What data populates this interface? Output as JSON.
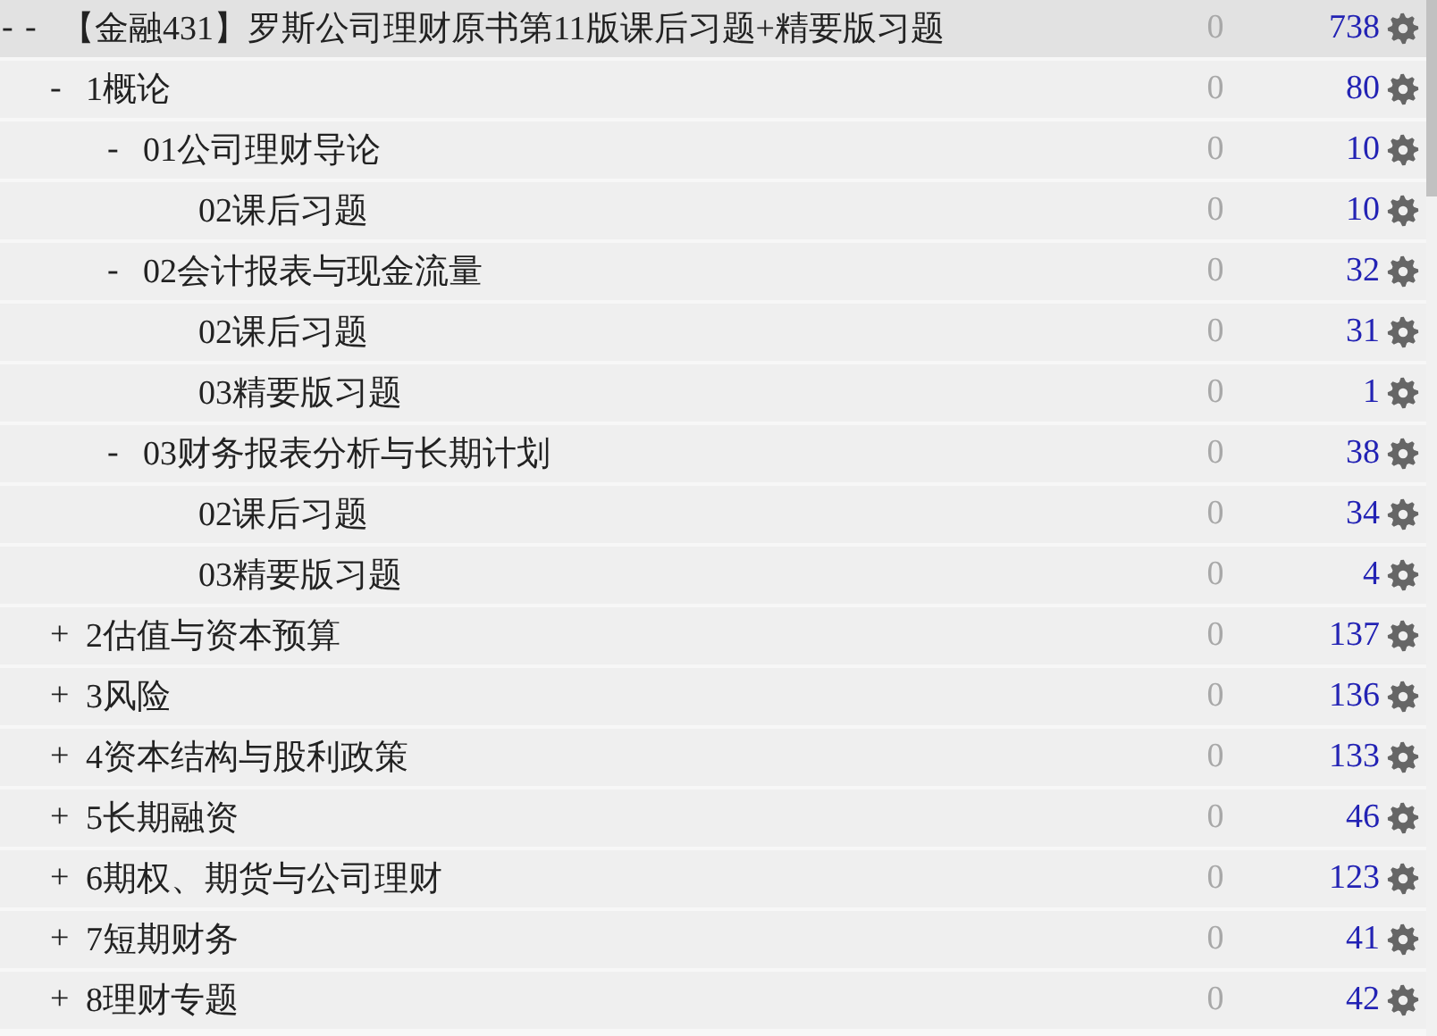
{
  "tree": [
    {
      "outer_toggle": "-",
      "toggle": "-",
      "label": "【金融431】罗斯公司理财原书第11版课后习题+精要版习题",
      "done": "0",
      "count": "738",
      "selected": true,
      "children": [
        {
          "toggle": "-",
          "label": "1概论",
          "done": "0",
          "count": "80",
          "selected": false,
          "children": [
            {
              "toggle": "-",
              "label": "01公司理财导论",
              "done": "0",
              "count": "10",
              "selected": false,
              "children": [
                {
                  "label": "02课后习题",
                  "done": "0",
                  "count": "10",
                  "selected": false
                }
              ]
            },
            {
              "toggle": "-",
              "label": "02会计报表与现金流量",
              "done": "0",
              "count": "32",
              "selected": false,
              "children": [
                {
                  "label": "02课后习题",
                  "done": "0",
                  "count": "31",
                  "selected": false
                },
                {
                  "label": "03精要版习题",
                  "done": "0",
                  "count": "1",
                  "selected": false
                }
              ]
            },
            {
              "toggle": "-",
              "label": "03财务报表分析与长期计划",
              "done": "0",
              "count": "38",
              "selected": false,
              "children": [
                {
                  "label": "02课后习题",
                  "done": "0",
                  "count": "34",
                  "selected": false
                },
                {
                  "label": "03精要版习题",
                  "done": "0",
                  "count": "4",
                  "selected": false
                }
              ]
            }
          ]
        },
        {
          "toggle": "+",
          "label": "2估值与资本预算",
          "done": "0",
          "count": "137",
          "selected": false
        },
        {
          "toggle": "+",
          "label": "3风险",
          "done": "0",
          "count": "136",
          "selected": false
        },
        {
          "toggle": "+",
          "label": "4资本结构与股利政策",
          "done": "0",
          "count": "133",
          "selected": false
        },
        {
          "toggle": "+",
          "label": "5长期融资",
          "done": "0",
          "count": "46",
          "selected": false
        },
        {
          "toggle": "+",
          "label": "6期权、期货与公司理财",
          "done": "0",
          "count": "123",
          "selected": false
        },
        {
          "toggle": "+",
          "label": "7短期财务",
          "done": "0",
          "count": "41",
          "selected": false
        },
        {
          "toggle": "+",
          "label": "8理财专题",
          "done": "0",
          "count": "42",
          "selected": false
        }
      ]
    }
  ]
}
